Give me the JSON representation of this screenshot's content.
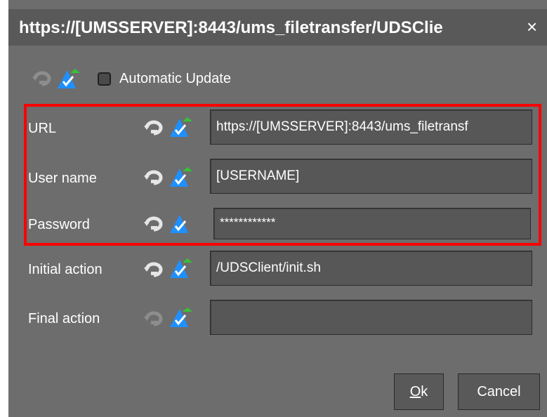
{
  "dialog": {
    "title": "https://[UMSSERVER]:8443/ums_filetransfer/UDSClie",
    "close_glyph": "×"
  },
  "automatic_update": {
    "label": "Automatic Update",
    "checked": false
  },
  "rows": [
    {
      "label": "URL",
      "value": "https://[UMSSERVER]:8443/ums_filetransf",
      "rollback_icon": "rollback-icon",
      "update_icon": "update-icon"
    },
    {
      "label": "User name",
      "value": "[USERNAME]",
      "rollback_icon": "rollback-icon",
      "update_icon": "update-icon"
    },
    {
      "label": "Password",
      "value": "************",
      "rollback_icon": "rollback-icon",
      "update_icon": "update-icon"
    },
    {
      "label": "Initial action",
      "value": "/UDSClient/init.sh",
      "rollback_icon": "rollback-icon",
      "update_icon": "update-icon"
    },
    {
      "label": "Final action",
      "value": "",
      "rollback_icon": "rollback-icon",
      "update_icon": "update-icon"
    }
  ],
  "buttons": {
    "ok_label": "k",
    "ok_mnemonic": "O",
    "cancel_label": "Cancel"
  },
  "colors": {
    "dialog_bg": "#6d6d6d",
    "titlebar_bg": "#595959",
    "field_bg": "#575757",
    "highlight": "#ff0000",
    "icon_blue": "#1e90ff",
    "icon_green": "#35c235"
  }
}
